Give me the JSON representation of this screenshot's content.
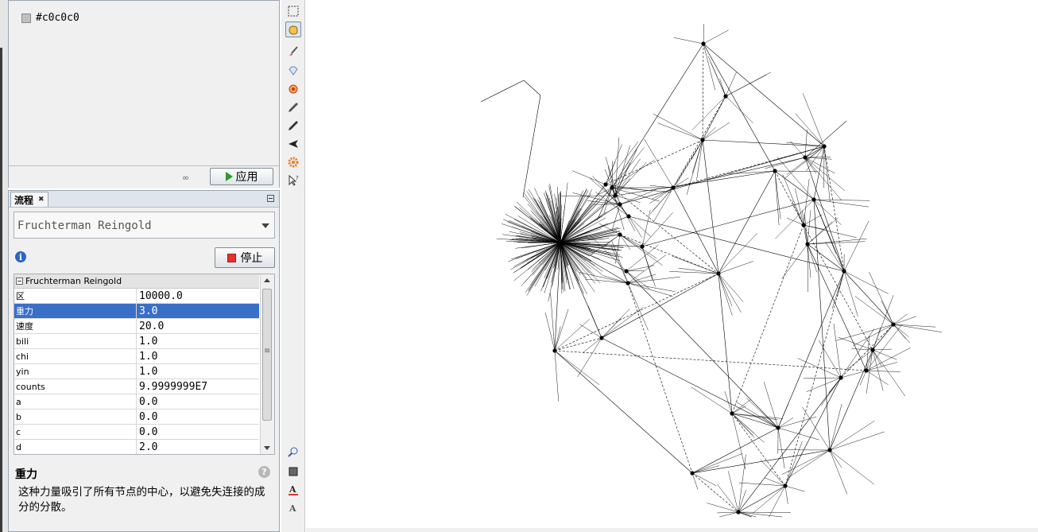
{
  "partition": {
    "items": [
      {
        "label": "#c0c0c0",
        "color": "#c0c0c0"
      }
    ],
    "link_icon": "link-icon",
    "apply_label": "应用"
  },
  "layout": {
    "tab_label": "流程",
    "algorithm": "Fruchterman Reingold",
    "stop_label": "停止",
    "group_label": "Fruchterman Reingold",
    "properties": [
      {
        "key": "区",
        "value": "10000.0"
      },
      {
        "key": "重力",
        "value": "3.0",
        "selected": true
      },
      {
        "key": "速度",
        "value": "20.0"
      },
      {
        "key": "bili",
        "value": "1.0"
      },
      {
        "key": "chi",
        "value": "1.0"
      },
      {
        "key": "yin",
        "value": "1.0"
      },
      {
        "key": "counts",
        "value": "9.9999999E7"
      },
      {
        "key": "a",
        "value": "0.0"
      },
      {
        "key": "b",
        "value": "0.0"
      },
      {
        "key": "c",
        "value": "0.0"
      },
      {
        "key": "d",
        "value": "2.0"
      }
    ],
    "description_title": "重力",
    "description_text": "这种力量吸引了所有节点的中心，以避免失连接的成分的分散。"
  },
  "toolbar": {
    "tools": [
      "rectangle-select-icon",
      "drag-hand-icon",
      "brush-icon",
      "diamond-icon",
      "heat-icon",
      "pencil-icon",
      "edge-pencil-icon",
      "airplane-icon",
      "gear-icon",
      "pointer-help-icon"
    ],
    "bottom_tools": [
      "zoom-icon",
      "background-color-icon",
      "text-color-icon",
      "text-size-icon"
    ]
  },
  "colors": {
    "selection": "#3a6fc8",
    "graph_edge": "#000000",
    "graph_node": "#000000"
  }
}
